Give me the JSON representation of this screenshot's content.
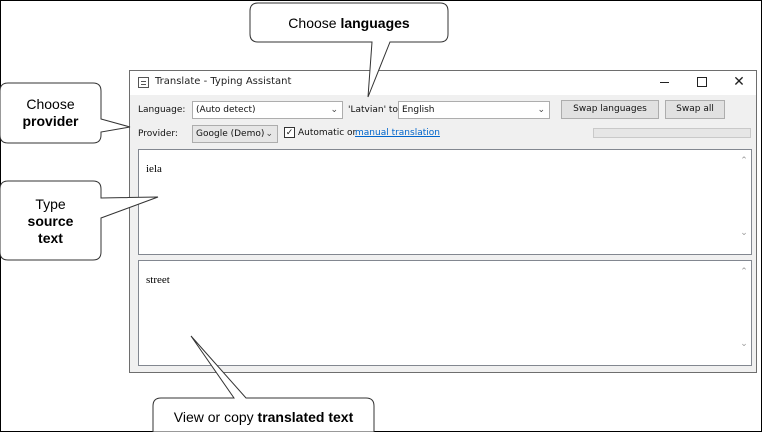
{
  "callouts": {
    "languages": {
      "normal": "Choose ",
      "bold": "languages"
    },
    "provider": {
      "line1": "Choose",
      "bold": "provider"
    },
    "source": {
      "line1": "Type",
      "bold1": "source",
      "bold2": "text"
    },
    "translated": {
      "normal": "View or copy ",
      "bold": "translated text"
    }
  },
  "window": {
    "title": "Translate - Typing Assistant",
    "close_glyph": "✕"
  },
  "toolbar": {
    "language_label": "Language:",
    "source_language": "(Auto detect)",
    "detected_text": "'Latvian' to",
    "target_language": "English",
    "swap_languages_label": "Swap languages",
    "swap_all_label": "Swap all",
    "provider_label": "Provider:",
    "provider_value": "Google (Demo)",
    "automatic_checked": "✓",
    "automatic_label": "Automatic or",
    "manual_link_label": "manual translation"
  },
  "source_text": "iela",
  "translated_text": "street",
  "icons": {
    "dropdown": "chevron-down-icon",
    "scroll_up": "scroll-up-icon",
    "scroll_down": "scroll-down-icon"
  },
  "colors": {
    "link": "#0066cc",
    "client_bg": "#f0f0f0"
  }
}
